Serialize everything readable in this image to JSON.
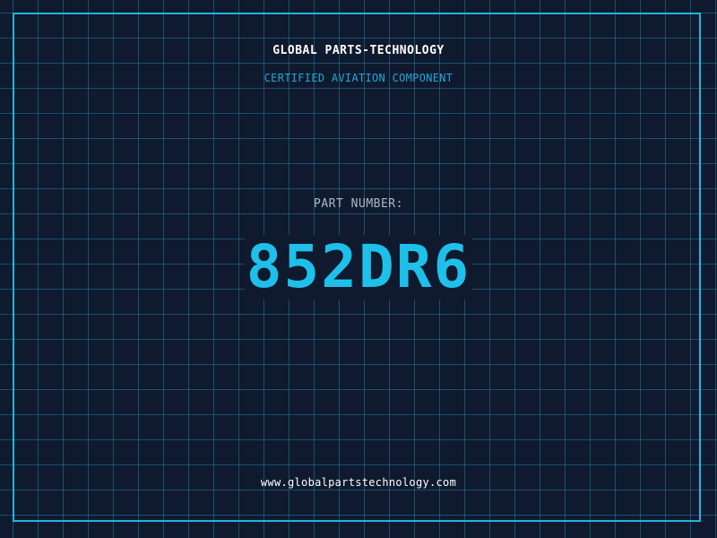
{
  "header": {
    "company": "GLOBAL PARTS-TECHNOLOGY",
    "subtitle": "CERTIFIED AVIATION COMPONENT"
  },
  "part": {
    "label": "PART NUMBER:",
    "number": "852DR6"
  },
  "footer": {
    "url": "www.globalpartstechnology.com"
  },
  "colors": {
    "background": "#0f1a2e",
    "grid": "#28789f",
    "frame": "#1fb6e0",
    "accent": "#1ec0ea",
    "subtitle": "#22a7d8",
    "label": "#aeb8c4",
    "text": "#ffffff"
  }
}
